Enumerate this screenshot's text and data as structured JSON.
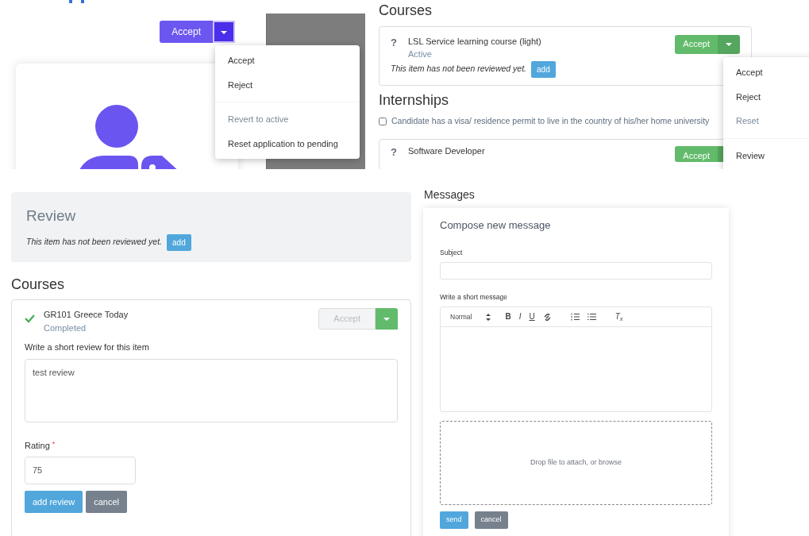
{
  "top_left": {
    "split_button": {
      "label": "Accept"
    },
    "menu": [
      {
        "kind": "item",
        "label": "Accept",
        "disabled": false
      },
      {
        "kind": "item",
        "label": "Reject",
        "disabled": false
      },
      {
        "kind": "divider"
      },
      {
        "kind": "item",
        "label": "Revert to active",
        "disabled": true
      },
      {
        "kind": "item",
        "label": "Reset application to pending",
        "disabled": false
      }
    ]
  },
  "top_right": {
    "courses": {
      "heading": "Courses",
      "items": [
        {
          "kind": "pending",
          "symbol": "?",
          "title": "LSL Service learning course (light)",
          "status": "Active",
          "review_note": "This item has not been reviewed yet.",
          "add_button": "add",
          "action": "Accept"
        }
      ]
    },
    "internships": {
      "heading": "Internships",
      "checkbox": {
        "label": "Candidate has a visa/ residence permit to live in the country of his/her home university",
        "checked": false
      },
      "items": [
        {
          "kind": "pending",
          "symbol": "?",
          "title": "Software Developer",
          "action": "Accept"
        }
      ]
    },
    "menu": [
      {
        "kind": "item",
        "label": "Accept",
        "disabled": false
      },
      {
        "kind": "item",
        "label": "Reject",
        "disabled": false
      },
      {
        "kind": "item",
        "label": "Reset",
        "disabled": true
      },
      {
        "kind": "divider"
      },
      {
        "kind": "item",
        "label": "Review",
        "disabled": false
      }
    ]
  },
  "bottom_left": {
    "review": {
      "title": "Review",
      "note": "This item has not been reviewed yet.",
      "add_button": "add"
    },
    "courses": {
      "heading": "Courses",
      "items": [
        {
          "kind": "completed",
          "title": "GR101 Greece Today",
          "status": "Completed",
          "action": {
            "label": "Accept",
            "disabled": true
          },
          "review_label": "Write a short review for this item",
          "review_text": "test review",
          "rating_label": "Rating",
          "required_mark": "*",
          "rating": "75",
          "buttons": [
            {
              "kind": "primary",
              "label": "add review"
            },
            {
              "kind": "secondary",
              "label": "cancel"
            }
          ]
        }
      ]
    }
  },
  "bottom_right": {
    "heading": "Messages",
    "title": "Compose new message",
    "subject_label": "Subject",
    "message_label": "Write a short message",
    "toolbar": {
      "format": "Normal",
      "tools": [
        {
          "kind": "bold",
          "label": "B"
        },
        {
          "kind": "italic",
          "label": "I"
        },
        {
          "kind": "underline",
          "label": "U"
        },
        {
          "kind": "link"
        },
        {
          "kind": "ordered-list"
        },
        {
          "kind": "bullet-list"
        },
        {
          "kind": "clean",
          "label": "T$_{x}$"
        }
      ]
    },
    "dropzone": "Drop file to attach, or browse",
    "buttons": [
      {
        "kind": "primary",
        "label": "send"
      },
      {
        "kind": "secondary",
        "label": "cancel"
      }
    ]
  }
}
